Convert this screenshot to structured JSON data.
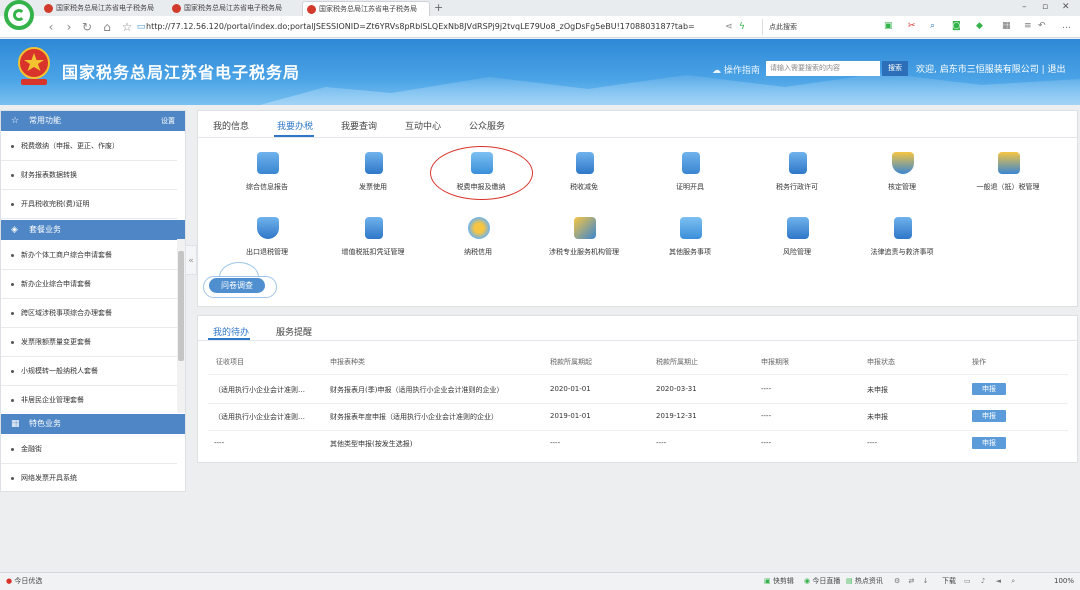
{
  "browser": {
    "tabs": [
      {
        "label": "国家税务总局江苏省电子税务局"
      },
      {
        "label": "国家税务总局江苏省电子税务局"
      },
      {
        "label": "国家税务总局江苏省电子税务局"
      }
    ],
    "new_tab": "+",
    "url": "http://77.12.56.120/portal/index.do;portalJSESSIONID=Zt6YRVs8pRblSLQExNb8JVdRSPj9j2tvqLE79Uo8_zOgDsFg5eBU!1708803187?tab=",
    "search_placeholder": "点此搜索"
  },
  "header": {
    "site_title": "国家税务总局江苏省电子税务局",
    "operation_guide": "操作指南",
    "search_placeholder": "请输入需要搜索的内容",
    "search_button": "搜索",
    "welcome": "欢迎, 启东市三恒服装有限公司",
    "logout": "退出"
  },
  "sidebar": {
    "common": {
      "title": "常用功能",
      "setting": "设置",
      "items": [
        "税费缴纳（申报、更正、作废）",
        "财务报表数据转换",
        "开具税收完税(费)证明"
      ]
    },
    "package": {
      "title": "套餐业务",
      "items": [
        "新办个体工商户综合申请套餐",
        "新办企业综合申请套餐",
        "跨区域涉税事项综合办理套餐",
        "发票限额票量变更套餐",
        "小规模转一般纳税人套餐",
        "非居民企业管理套餐"
      ]
    },
    "special": {
      "title": "特色业务",
      "items": [
        "金融街",
        "网络发票开具系统"
      ]
    }
  },
  "main": {
    "tabs": [
      "我的信息",
      "我要办税",
      "我要查询",
      "互动中心",
      "公众服务"
    ],
    "active_tab": "我要办税",
    "tiles_row1": [
      "综合信息报告",
      "发票使用",
      "税费申报及缴纳",
      "税收减免",
      "证明开具",
      "税务行政许可",
      "核定管理",
      "一般退（抵）税管理"
    ],
    "tiles_row2": [
      "出口退税管理",
      "增值税抵扣凭证管理",
      "纳税信用",
      "涉税专业服务机构管理",
      "其他服务事项",
      "风险管理",
      "法律追责与救济事项"
    ],
    "survey_button": "问卷调查"
  },
  "tasks": {
    "tabs": [
      "我的待办",
      "服务提醒"
    ],
    "columns": [
      "征收项目",
      "申报表种类",
      "税款所属期起",
      "税款所属期止",
      "申报期限",
      "申报状态",
      "操作"
    ],
    "rows": [
      {
        "item": "（适用执行小企业会计准则…",
        "type": "财务报表月(季)申报（适用执行小企业会计准则的企业）",
        "start": "2020-01-01",
        "end": "2020-03-31",
        "deadline": "----",
        "status": "未申报",
        "action": "申报"
      },
      {
        "item": "（适用执行小企业会计准则…",
        "type": "财务报表年度申报（适用执行小企业会计准则的企业）",
        "start": "2019-01-01",
        "end": "2019-12-31",
        "deadline": "----",
        "status": "未申报",
        "action": "申报"
      },
      {
        "item": "----",
        "type": "其他类型申报(按发生选报)",
        "start": "----",
        "end": "----",
        "deadline": "----",
        "status": "----",
        "action": "申报"
      }
    ]
  },
  "statusbar": {
    "left": "今日优选",
    "quick_clip": "快剪辑",
    "live": "今日直播",
    "news": "热点资讯",
    "download": "下载",
    "zoom": "100%"
  },
  "colors": {
    "accent": "#2f77c8",
    "sidebar_header": "#4e86c6",
    "highlight_circle": "#d9342b"
  }
}
